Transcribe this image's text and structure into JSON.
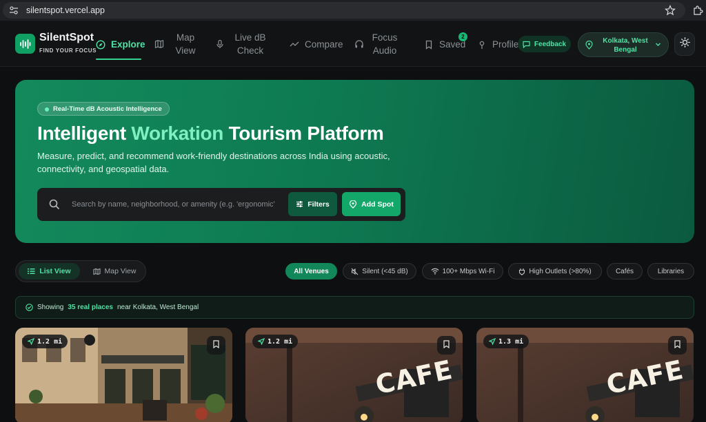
{
  "browser": {
    "url": "silentspot.vercel.app"
  },
  "brand": {
    "name": "SilentSpot",
    "tagline": "FIND YOUR FOCUS"
  },
  "nav": {
    "items": [
      {
        "label": "Explore",
        "icon": "compass-icon"
      },
      {
        "label": "Map View",
        "icon": "map-icon"
      },
      {
        "label": "Live dB Check",
        "icon": "mic-icon"
      },
      {
        "label": "Compare",
        "icon": "compare-icon"
      },
      {
        "label": "Focus Audio",
        "icon": "headphones-icon"
      },
      {
        "label": "Saved",
        "icon": "bookmark-icon",
        "badge": "2"
      },
      {
        "label": "Profile",
        "icon": "profile-icon"
      }
    ],
    "feedback": "Feedback",
    "location": "Kolkata, West Bengal"
  },
  "hero": {
    "chip": "Real-Time dB Acoustic Intelligence",
    "title_pre": "Intelligent",
    "title_accent": "Workation",
    "title_post": "Tourism Platform",
    "subtitle": "Measure, predict, and recommend work-friendly destinations across India using acoustic, connectivity, and geospatial data.",
    "search_placeholder": "Search by name, neighborhood, or amenity (e.g. 'ergonomic')",
    "filters_label": "Filters",
    "add_label": "Add Spot"
  },
  "view_toggle": {
    "list": "List View",
    "map": "Map View"
  },
  "filters": [
    "All Venues",
    "Silent (<45 dB)",
    "100+ Mbps Wi-Fi",
    "High Outlets (>80%)",
    "Cafés",
    "Libraries"
  ],
  "status": {
    "prefix": "Showing",
    "count": "35 real places",
    "suffix": "near Kolkata, West Bengal"
  },
  "cards": [
    {
      "distance": "1.2 mi"
    },
    {
      "distance": "1.2 mi",
      "sign": "CAFE"
    },
    {
      "distance": "1.3 mi",
      "sign": "CAFE"
    }
  ],
  "colors": {
    "accent": "#35d391",
    "hero": "#0e7a52",
    "background": "#0e0f10"
  }
}
